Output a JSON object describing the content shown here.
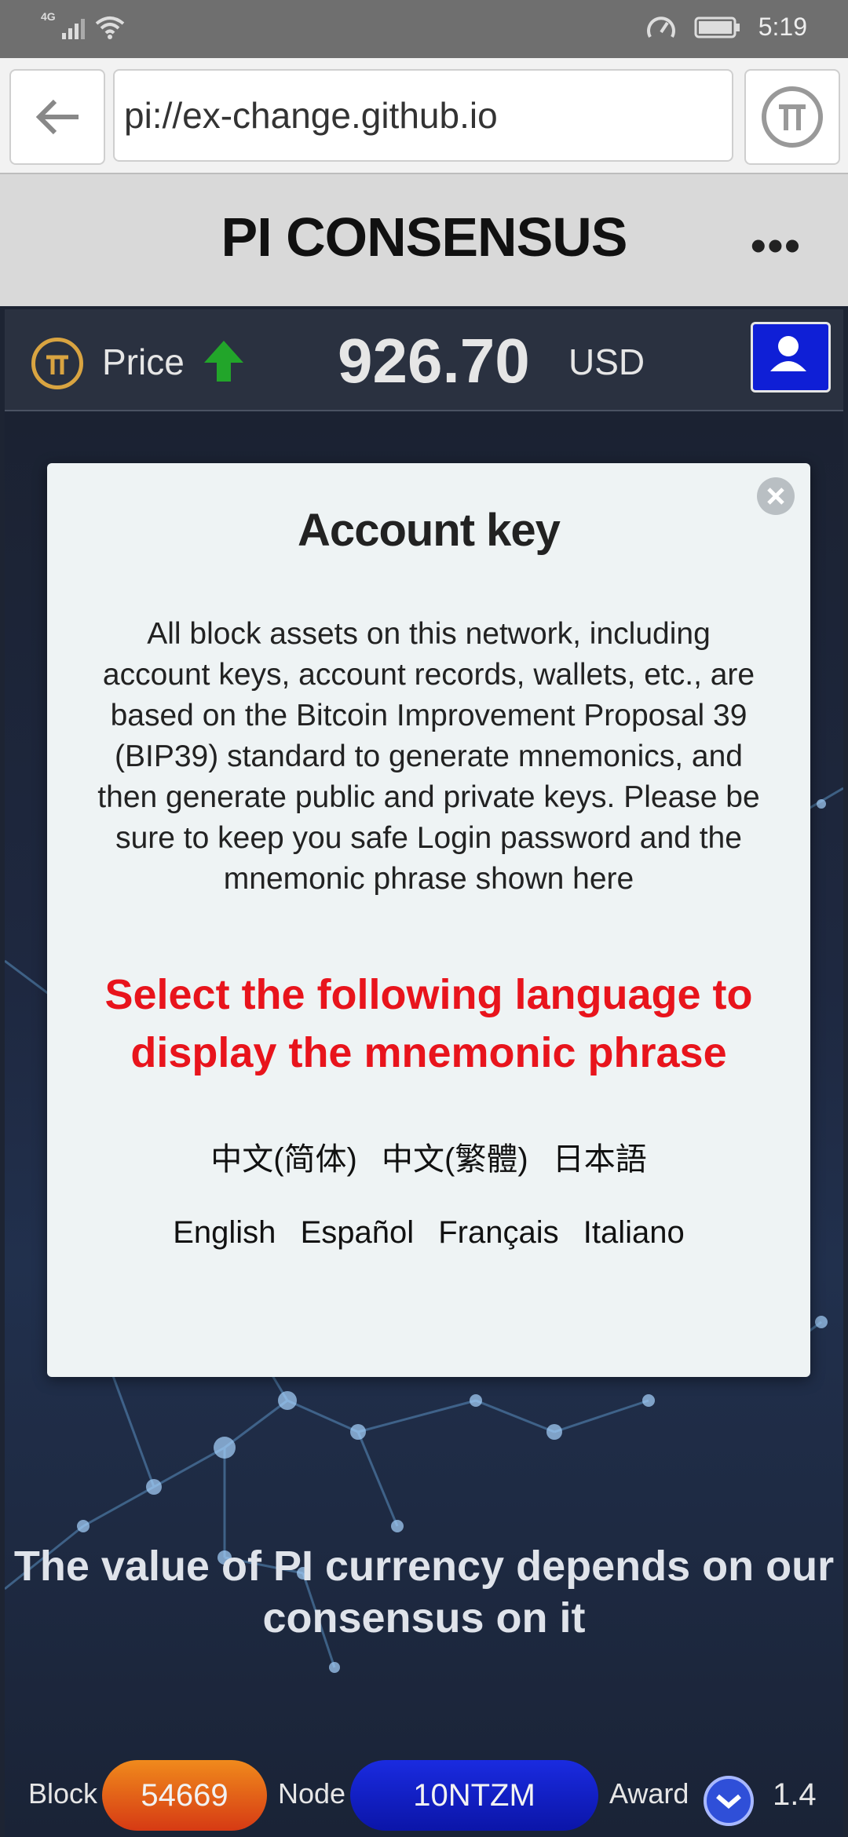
{
  "status_bar": {
    "network": "4G",
    "time": "5:19"
  },
  "browser": {
    "url": "pi://ex-change.github.io"
  },
  "header": {
    "title": "PI CONSENSUS",
    "more": "•••"
  },
  "price_bar": {
    "label": "Price",
    "value": "926.70",
    "unit": "USD",
    "trend": "up"
  },
  "modal": {
    "title": "Account key",
    "body": "All block assets on this network, including account keys, account records, wallets, etc., are based on the Bitcoin Improvement Proposal 39 (BIP39) standard to generate mnemonics, and then generate public and private keys. Please be sure to keep you safe Login password and the mnemonic phrase shown here",
    "select_prompt": "Select the following language to display the mnemonic phrase",
    "languages_row1": [
      "中文(简体)",
      "中文(繁體)",
      "日本語"
    ],
    "languages_row2": [
      "English",
      "Español",
      "Français",
      "Italiano"
    ]
  },
  "hero_text": "The value of PI currency depends on our consensus on it",
  "bottom_bar": {
    "block_label": "Block",
    "block_value": "54669",
    "node_label": "Node",
    "node_value": "10NTZM",
    "award_label": "Award",
    "award_value": "1.4"
  },
  "colors": {
    "accent_red": "#e8141c",
    "button_blue": "#0f1fd6",
    "block_orange": "#e8621a",
    "up_green": "#22a52a"
  }
}
